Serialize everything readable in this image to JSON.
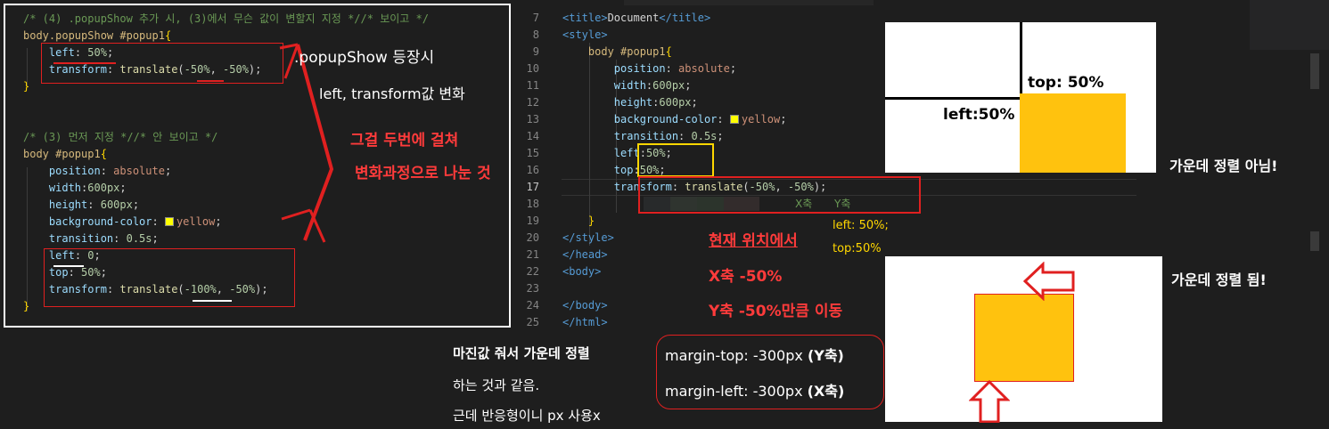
{
  "left_panel": {
    "code_lines": [
      {
        "parts": [
          {
            "c": "c-com",
            "t": "/* (4) .popupShow 추가 시, (3)에서 무슨 값이 변할지 지정 *//* 보이고 */"
          }
        ]
      },
      {
        "parts": [
          {
            "c": "c-sel",
            "t": "body.popupShow #popup1"
          },
          {
            "c": "c-br",
            "t": "{"
          }
        ]
      },
      {
        "parts": [
          {
            "c": "c-txt",
            "t": "    "
          },
          {
            "c": "c-prop",
            "t": "left"
          },
          {
            "c": "c-txt",
            "t": ": "
          },
          {
            "c": "c-num",
            "t": "50%"
          },
          {
            "c": "c-txt",
            "t": ";"
          }
        ]
      },
      {
        "parts": [
          {
            "c": "c-txt",
            "t": "    "
          },
          {
            "c": "c-prop",
            "t": "transform"
          },
          {
            "c": "c-txt",
            "t": ": "
          },
          {
            "c": "c-fn",
            "t": "translate"
          },
          {
            "c": "c-txt",
            "t": "("
          },
          {
            "c": "c-num",
            "t": "-50%"
          },
          {
            "c": "c-txt",
            "t": ", "
          },
          {
            "c": "c-num",
            "t": "-50%"
          },
          {
            "c": "c-txt",
            "t": ");"
          }
        ]
      },
      {
        "parts": [
          {
            "c": "c-br",
            "t": "}"
          }
        ]
      },
      {
        "parts": []
      },
      {
        "parts": []
      },
      {
        "parts": [
          {
            "c": "c-com",
            "t": "/* (3) 먼저 지정 *//* 안 보이고 */"
          }
        ]
      },
      {
        "parts": [
          {
            "c": "c-sel",
            "t": "body #popup1"
          },
          {
            "c": "c-br",
            "t": "{"
          }
        ]
      },
      {
        "parts": [
          {
            "c": "c-txt",
            "t": "    "
          },
          {
            "c": "c-prop",
            "t": "position"
          },
          {
            "c": "c-txt",
            "t": ": "
          },
          {
            "c": "c-val",
            "t": "absolute"
          },
          {
            "c": "c-txt",
            "t": ";"
          }
        ]
      },
      {
        "parts": [
          {
            "c": "c-txt",
            "t": "    "
          },
          {
            "c": "c-prop",
            "t": "width"
          },
          {
            "c": "c-txt",
            "t": ":"
          },
          {
            "c": "c-num",
            "t": "600px"
          },
          {
            "c": "c-txt",
            "t": ";"
          }
        ]
      },
      {
        "parts": [
          {
            "c": "c-txt",
            "t": "    "
          },
          {
            "c": "c-prop",
            "t": "height"
          },
          {
            "c": "c-txt",
            "t": ": "
          },
          {
            "c": "c-num",
            "t": "600px"
          },
          {
            "c": "c-txt",
            "t": ";"
          }
        ]
      },
      {
        "parts": [
          {
            "c": "c-txt",
            "t": "    "
          },
          {
            "c": "c-prop",
            "t": "background-color"
          },
          {
            "c": "c-txt",
            "t": ": "
          },
          {
            "c": "swatch",
            "t": ""
          },
          {
            "c": "c-val",
            "t": "yellow"
          },
          {
            "c": "c-txt",
            "t": ";"
          }
        ]
      },
      {
        "parts": [
          {
            "c": "c-txt",
            "t": "    "
          },
          {
            "c": "c-prop",
            "t": "transition"
          },
          {
            "c": "c-txt",
            "t": ": "
          },
          {
            "c": "c-num",
            "t": "0.5s"
          },
          {
            "c": "c-txt",
            "t": ";"
          }
        ]
      },
      {
        "parts": [
          {
            "c": "c-txt",
            "t": "    "
          },
          {
            "c": "c-prop",
            "t": "left"
          },
          {
            "c": "c-txt",
            "t": ": "
          },
          {
            "c": "c-num",
            "t": "0"
          },
          {
            "c": "c-txt",
            "t": ";"
          }
        ]
      },
      {
        "parts": [
          {
            "c": "c-txt",
            "t": "    "
          },
          {
            "c": "c-prop",
            "t": "top"
          },
          {
            "c": "c-txt",
            "t": ": "
          },
          {
            "c": "c-num",
            "t": "50%"
          },
          {
            "c": "c-txt",
            "t": ";"
          }
        ]
      },
      {
        "parts": [
          {
            "c": "c-txt",
            "t": "    "
          },
          {
            "c": "c-prop",
            "t": "transform"
          },
          {
            "c": "c-txt",
            "t": ": "
          },
          {
            "c": "c-fn",
            "t": "translate"
          },
          {
            "c": "c-txt",
            "t": "("
          },
          {
            "c": "c-num",
            "t": "-100%"
          },
          {
            "c": "c-txt",
            "t": ", "
          },
          {
            "c": "c-num",
            "t": "-50%"
          },
          {
            "c": "c-txt",
            "t": ");"
          }
        ]
      },
      {
        "parts": [
          {
            "c": "c-br",
            "t": "}"
          }
        ]
      }
    ],
    "note_popupshow": ".popupShow 등장시",
    "note_values": "left, transform값 변화",
    "note_twice_1": "그걸 두번에 걸쳐",
    "note_twice_2": "변화과정으로 나눈 것"
  },
  "editor": {
    "line_numbers": [
      "7",
      "8",
      "9",
      "10",
      "11",
      "12",
      "13",
      "14",
      "15",
      "16",
      "17",
      "18",
      "19",
      "20",
      "21",
      "22",
      "23",
      "24",
      "25"
    ],
    "code_lines": [
      {
        "parts": [
          {
            "c": "c-tag",
            "t": "<title>"
          },
          {
            "c": "c-txt",
            "t": "Document"
          },
          {
            "c": "c-tag",
            "t": "</title>"
          }
        ]
      },
      {
        "parts": [
          {
            "c": "c-tag",
            "t": "<style>"
          }
        ]
      },
      {
        "parts": [
          {
            "c": "c-txt",
            "t": "    "
          },
          {
            "c": "c-sel",
            "t": "body #popup1"
          },
          {
            "c": "c-br",
            "t": "{"
          }
        ]
      },
      {
        "parts": [
          {
            "c": "c-txt",
            "t": "        "
          },
          {
            "c": "c-prop",
            "t": "position"
          },
          {
            "c": "c-txt",
            "t": ": "
          },
          {
            "c": "c-val",
            "t": "absolute"
          },
          {
            "c": "c-txt",
            "t": ";"
          }
        ]
      },
      {
        "parts": [
          {
            "c": "c-txt",
            "t": "        "
          },
          {
            "c": "c-prop",
            "t": "width"
          },
          {
            "c": "c-txt",
            "t": ":"
          },
          {
            "c": "c-num",
            "t": "600px"
          },
          {
            "c": "c-txt",
            "t": ";"
          }
        ]
      },
      {
        "parts": [
          {
            "c": "c-txt",
            "t": "        "
          },
          {
            "c": "c-prop",
            "t": "height"
          },
          {
            "c": "c-txt",
            "t": ":"
          },
          {
            "c": "c-num",
            "t": "600px"
          },
          {
            "c": "c-txt",
            "t": ";"
          }
        ]
      },
      {
        "parts": [
          {
            "c": "c-txt",
            "t": "        "
          },
          {
            "c": "c-prop",
            "t": "background-color"
          },
          {
            "c": "c-txt",
            "t": ": "
          },
          {
            "c": "swatch",
            "t": ""
          },
          {
            "c": "c-val",
            "t": "yellow"
          },
          {
            "c": "c-txt",
            "t": ";"
          }
        ]
      },
      {
        "parts": [
          {
            "c": "c-txt",
            "t": "        "
          },
          {
            "c": "c-prop",
            "t": "transition"
          },
          {
            "c": "c-txt",
            "t": ": "
          },
          {
            "c": "c-num",
            "t": "0.5s"
          },
          {
            "c": "c-txt",
            "t": ";"
          }
        ]
      },
      {
        "parts": [
          {
            "c": "c-txt",
            "t": "        "
          },
          {
            "c": "c-prop",
            "t": "left"
          },
          {
            "c": "c-txt",
            "t": ":"
          },
          {
            "c": "c-num",
            "t": "50%"
          },
          {
            "c": "c-txt",
            "t": ";"
          }
        ]
      },
      {
        "parts": [
          {
            "c": "c-txt",
            "t": "        "
          },
          {
            "c": "c-prop",
            "t": "top"
          },
          {
            "c": "c-txt",
            "t": ":"
          },
          {
            "c": "c-num",
            "t": "50%"
          },
          {
            "c": "c-txt",
            "t": ";"
          }
        ]
      },
      {
        "parts": [
          {
            "c": "c-txt",
            "t": "        "
          },
          {
            "c": "c-prop",
            "t": "transform"
          },
          {
            "c": "c-txt",
            "t": ": "
          },
          {
            "c": "c-fn",
            "t": "translate"
          },
          {
            "c": "c-txt",
            "t": "("
          },
          {
            "c": "c-num",
            "t": "-50%"
          },
          {
            "c": "c-txt",
            "t": ", "
          },
          {
            "c": "c-num",
            "t": "-50%"
          },
          {
            "c": "c-txt",
            "t": ");"
          }
        ]
      },
      {
        "parts": []
      },
      {
        "parts": [
          {
            "c": "c-txt",
            "t": "    "
          },
          {
            "c": "c-br",
            "t": "}"
          }
        ]
      },
      {
        "parts": [
          {
            "c": "c-tag",
            "t": "</style>"
          }
        ]
      },
      {
        "parts": [
          {
            "c": "c-tag",
            "t": "</head>"
          }
        ]
      },
      {
        "parts": [
          {
            "c": "c-tag",
            "t": "<body>"
          }
        ]
      },
      {
        "parts": []
      },
      {
        "parts": [
          {
            "c": "c-tag",
            "t": "</body>"
          }
        ]
      },
      {
        "parts": [
          {
            "c": "c-tag",
            "t": "</html>"
          }
        ]
      }
    ],
    "axis_x": "X축",
    "axis_y": "Y축",
    "hint_left": "left: 50%;",
    "hint_top": "top:50%",
    "explain_1": "현재 위치에서",
    "explain_2": "X축 -50%",
    "explain_3": "Y축 -50%만큼 이동"
  },
  "margin_note": {
    "title": "마진값 줘서 가운데 정렬",
    "line2": "하는 것과 같음.",
    "line3": "근데 반응형이니 px 사용x",
    "margin_top": "margin-top: -300px",
    "margin_top_axis": "(Y축)",
    "margin_left": "margin-left: -300px",
    "margin_left_axis": "(X축)"
  },
  "diagram_top": {
    "label_top": "top: 50%",
    "label_left": "left:50%",
    "caption": "가운데 정렬 아님!"
  },
  "diagram_bottom": {
    "caption": "가운데 정렬 됨!"
  },
  "colors": {
    "box_yellow": "#ffc20e",
    "accent_red": "#e02020"
  }
}
